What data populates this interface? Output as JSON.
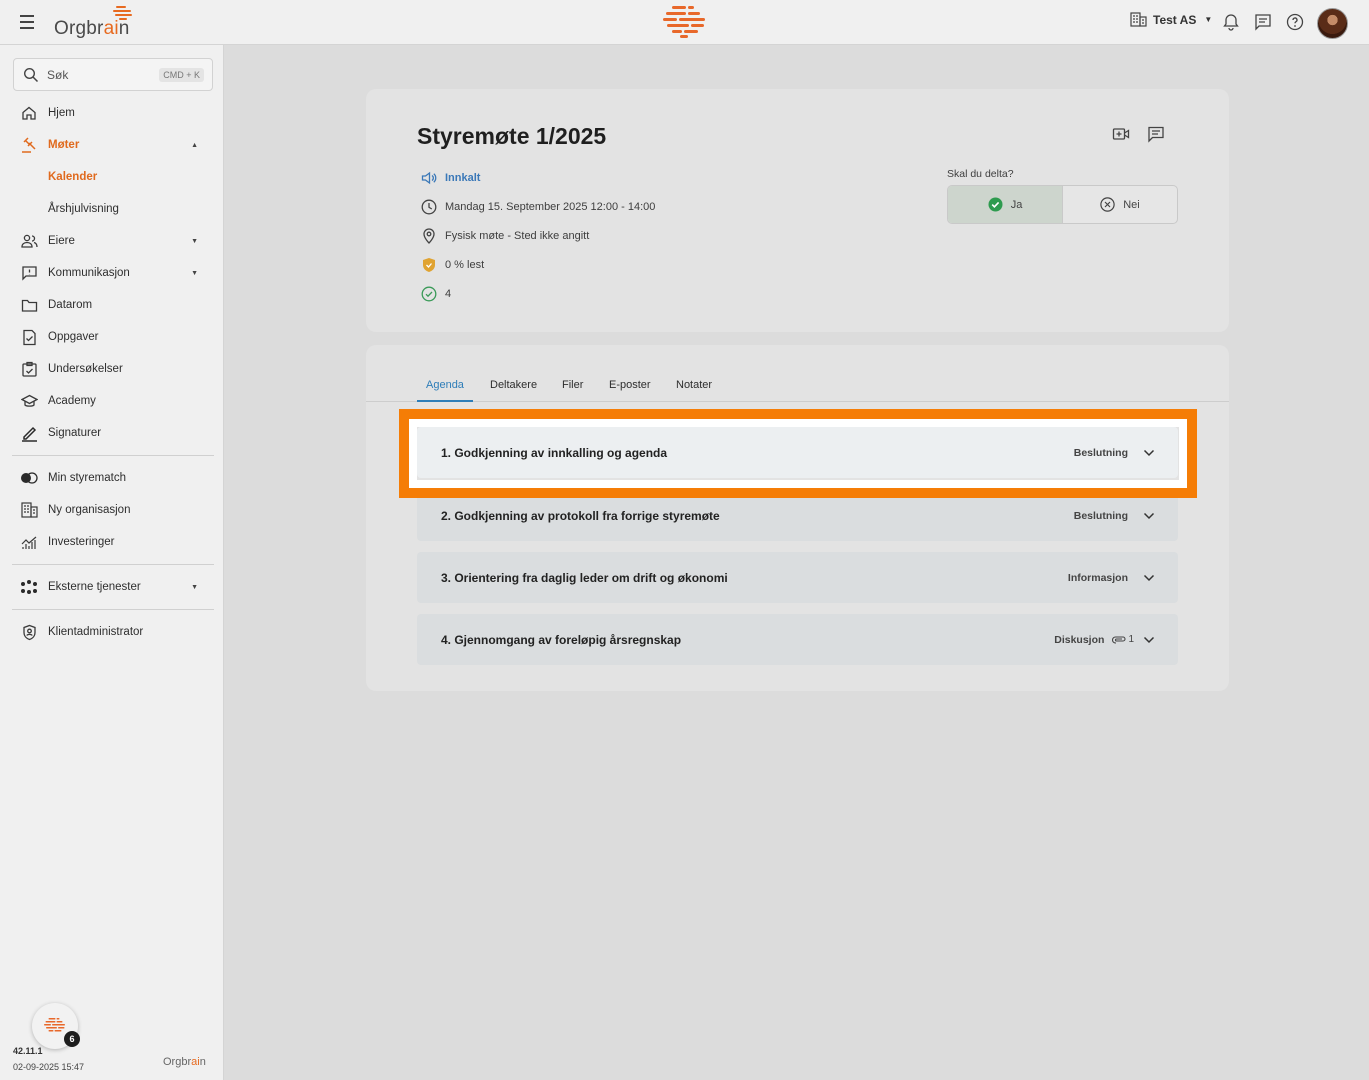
{
  "header": {
    "brand_prefix": "Orgbr",
    "brand_highlight": "ai",
    "brand_suffix": "n",
    "org_name": "Test AS"
  },
  "search": {
    "placeholder": "Søk",
    "shortcut": "CMD + K"
  },
  "nav": {
    "items": [
      {
        "label": "Hjem",
        "icon": "home-icon"
      },
      {
        "label": "Møter",
        "icon": "gavel-icon"
      },
      {
        "label": "Kalender"
      },
      {
        "label": "Årshjulvisning"
      },
      {
        "label": "Eiere",
        "icon": "people-icon"
      },
      {
        "label": "Kommunikasjon",
        "icon": "chat-icon"
      },
      {
        "label": "Datarom",
        "icon": "folder-icon"
      },
      {
        "label": "Oppgaver",
        "icon": "task-icon"
      },
      {
        "label": "Undersøkelser",
        "icon": "survey-icon"
      },
      {
        "label": "Academy",
        "icon": "academy-icon"
      },
      {
        "label": "Signaturer",
        "icon": "pen-icon"
      },
      {
        "label": "Min styrematch",
        "icon": "toggle-icon"
      },
      {
        "label": "Ny organisasjon",
        "icon": "building-icon"
      },
      {
        "label": "Investeringer",
        "icon": "chart-icon"
      },
      {
        "label": "Eksterne tjenester",
        "icon": "network-icon"
      },
      {
        "label": "Klientadministrator",
        "icon": "shield-icon"
      }
    ]
  },
  "footer": {
    "badge_count": "6",
    "version": "42.11.1",
    "build_date": "02-09-2025 15:47",
    "brand_prefix": "Orgbr",
    "brand_highlight": "ai",
    "brand_suffix": "n"
  },
  "meeting": {
    "title": "Styremøte 1/2025",
    "status": "Innkalt",
    "datetime": "Mandag 15. September 2025 12:00 - 14:00",
    "location": "Fysisk møte - Sted ikke angitt",
    "read": "0 % lest",
    "approved_count": "4",
    "attend_question": "Skal du delta?",
    "attend_yes": "Ja",
    "attend_no": "Nei"
  },
  "tabs": [
    "Agenda",
    "Deltakere",
    "Filer",
    "E-poster",
    "Notater"
  ],
  "agenda": [
    {
      "title": "1. Godkjenning av innkalling og agenda",
      "type": "Beslutning",
      "files": ""
    },
    {
      "title": "2. Godkjenning av protokoll fra forrige styremøte",
      "type": "Beslutning",
      "files": ""
    },
    {
      "title": "3. Orientering fra daglig leder om drift og økonomi",
      "type": "Informasjon",
      "files": ""
    },
    {
      "title": "4. Gjennomgang av foreløpig årsregnskap",
      "type": "Diskusjon",
      "files": "1"
    }
  ],
  "colors": {
    "accent": "#e76a20",
    "link": "#2d7db8",
    "highlight": "#f57d06"
  }
}
